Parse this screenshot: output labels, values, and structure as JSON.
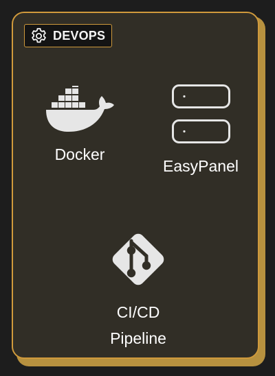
{
  "section": {
    "title": "DEVOPS",
    "icon": "gear-icon"
  },
  "tools": [
    {
      "name": "Docker",
      "icon": "docker-whale-icon"
    },
    {
      "name": "EasyPanel",
      "icon": "server-rack-icon"
    },
    {
      "name": "CI/CD",
      "subname": "Pipeline",
      "icon": "git-branch-icon"
    }
  ],
  "colors": {
    "background": "#1d1d1d",
    "card": "#312e26",
    "accent": "#d09a3c",
    "icon": "#e6e6e6",
    "text": "#ffffff"
  }
}
